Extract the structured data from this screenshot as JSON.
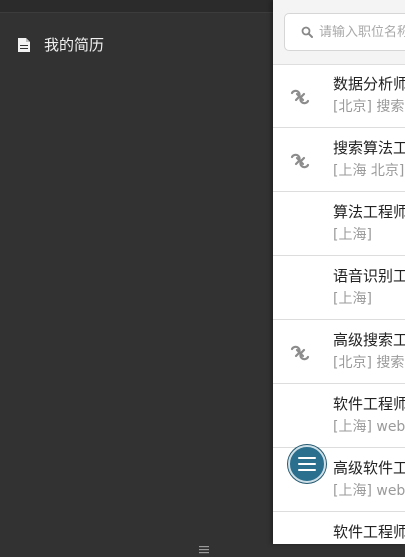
{
  "sidebar": {
    "items": [
      {
        "label": "我的简历",
        "icon": "document-icon"
      }
    ]
  },
  "search": {
    "placeholder": "请输入职位名称",
    "value": "",
    "icon": "search-icon"
  },
  "jobs": [
    {
      "title": "数据分析师",
      "meta": "[北京] 搜索",
      "linked": true
    },
    {
      "title": "搜索算法工程师",
      "meta": "[上海 北京]",
      "linked": true
    },
    {
      "title": "算法工程师",
      "meta": "[上海]",
      "linked": false
    },
    {
      "title": "语音识别工程师",
      "meta": "[上海]",
      "linked": false
    },
    {
      "title": "高级搜索工程师",
      "meta": "[北京] 搜索",
      "linked": true
    },
    {
      "title": "软件工程师",
      "meta": "[上海] web",
      "linked": false
    },
    {
      "title": "高级软件工程师",
      "meta": "[上海] web",
      "linked": false
    },
    {
      "title": "软件工程师",
      "meta": "",
      "linked": false
    }
  ],
  "fab": {
    "icon": "menu-icon"
  },
  "colors": {
    "background": "#323232",
    "panel": "#ffffff",
    "accent": "#2a6f8e"
  }
}
